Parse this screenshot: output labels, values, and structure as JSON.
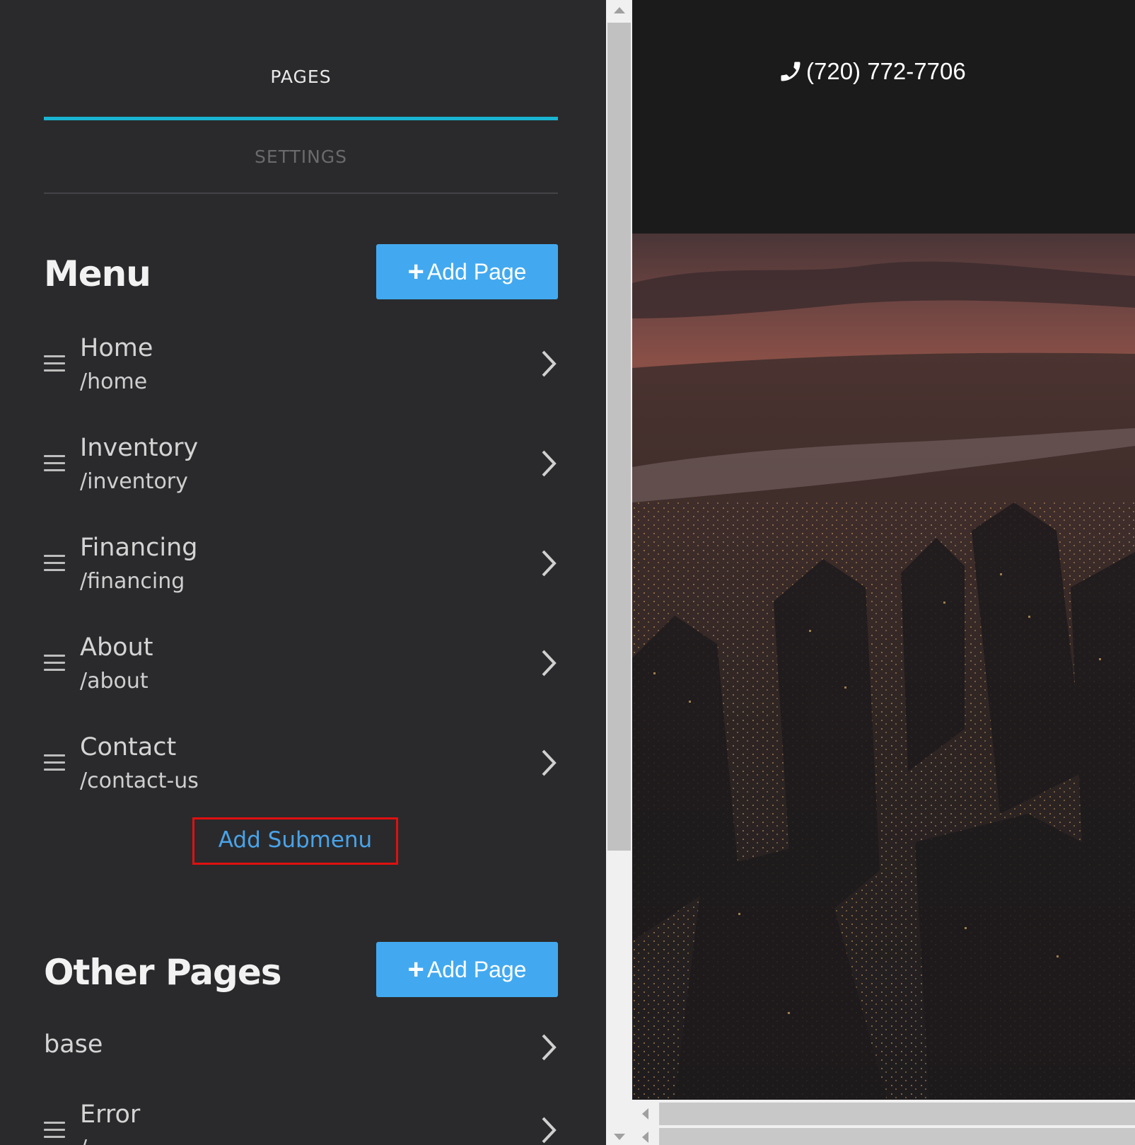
{
  "tabs": {
    "pages": "PAGES",
    "settings": "SETTINGS"
  },
  "menu": {
    "title": "Menu",
    "add_button": {
      "icon": "plus-icon",
      "label": "Add Page"
    },
    "items": [
      {
        "name": "Home",
        "path": "/home"
      },
      {
        "name": "Inventory",
        "path": "/inventory"
      },
      {
        "name": "Financing",
        "path": "/financing"
      },
      {
        "name": "About",
        "path": "/about"
      },
      {
        "name": "Contact",
        "path": "/contact-us"
      }
    ],
    "add_submenu": "Add Submenu"
  },
  "other_pages": {
    "title": "Other Pages",
    "add_button": {
      "icon": "plus-icon",
      "label": "Add Page"
    },
    "items": [
      {
        "name": "base"
      },
      {
        "name": "Error",
        "path": "/"
      }
    ]
  },
  "preview": {
    "phone_icon": "phone-icon",
    "phone": "(720) 772-7706"
  },
  "colors": {
    "accent": "#1ab4d2",
    "button": "#42a9f0",
    "highlight_box": "#e01010",
    "link": "#4aa3e8"
  }
}
